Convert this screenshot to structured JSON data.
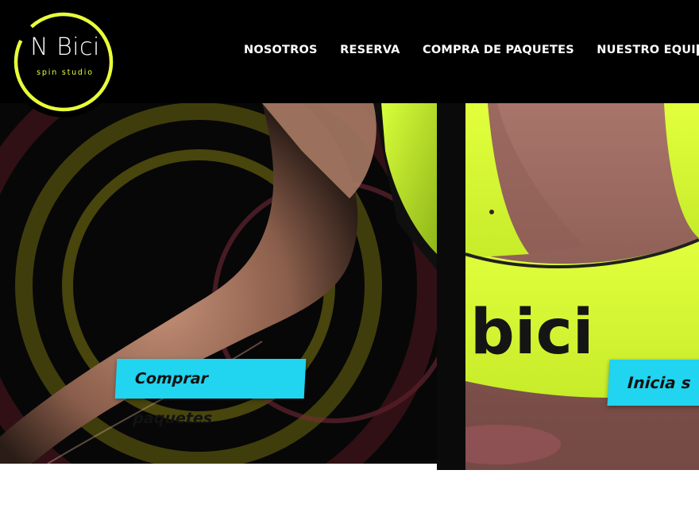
{
  "brand": {
    "logo_name": "N Bici",
    "logo_tagline": "spin studio",
    "accent_color": "#e9ff3a"
  },
  "nav": {
    "items": [
      {
        "label": "NOSOTROS"
      },
      {
        "label": "RESERVA"
      },
      {
        "label": "COMPRA DE PAQUETES"
      },
      {
        "label": "NUESTRO EQUIPO"
      }
    ]
  },
  "hero": {
    "left_cta": "Comprar paquetes",
    "right_cta": "Inicia s",
    "right_photo_text": "bici",
    "button_color": "#21d4f0"
  }
}
